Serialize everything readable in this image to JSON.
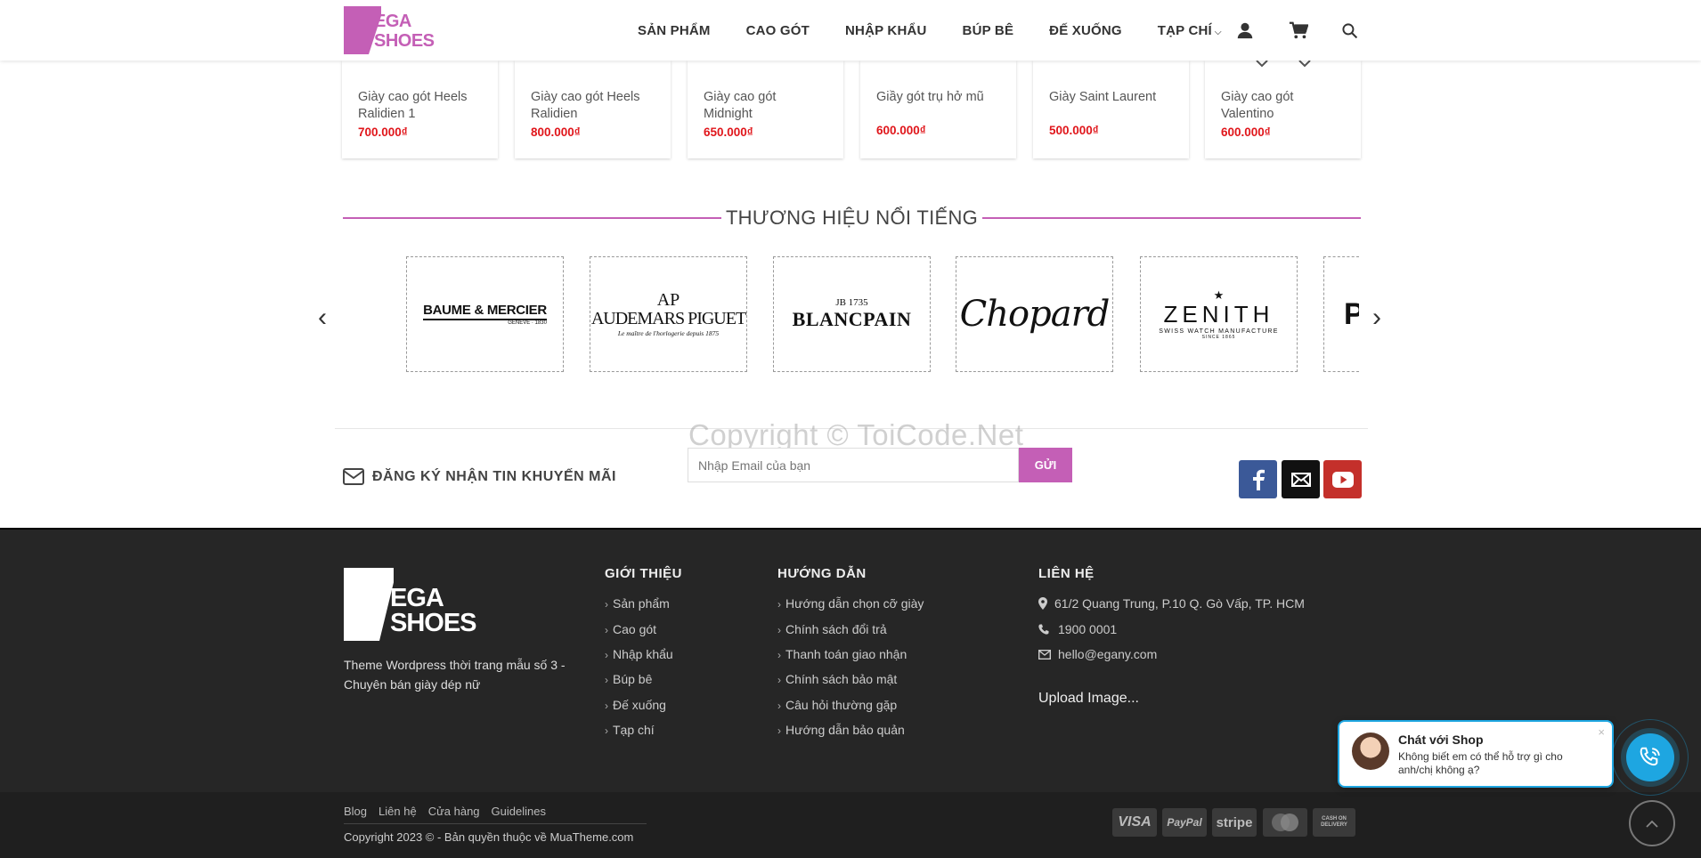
{
  "header": {
    "logo_line1": "EGA",
    "logo_line2": "SHOES",
    "nav": [
      "SẢN PHẨM",
      "CAO GÓT",
      "NHẬP KHẨU",
      "BÚP BÊ",
      "ĐẾ XUỐNG",
      "TẠP CHÍ"
    ],
    "icons": [
      "user-icon",
      "cart-icon",
      "search-icon"
    ]
  },
  "products": [
    {
      "name": "Giày cao gót Heels Ralidien 1",
      "price": "700.000₫"
    },
    {
      "name": "Giày cao gót Heels Ralidien",
      "price": "800.000₫"
    },
    {
      "name": "Giày cao gót Midnight",
      "price": "650.000₫"
    },
    {
      "name": "Giầy gót trụ hở mũ",
      "price": "600.000₫"
    },
    {
      "name": "Giày Saint Laurent",
      "price": "500.000₫"
    },
    {
      "name": "Giày cao gót Valentino",
      "price": "600.000₫"
    }
  ],
  "brands_section": {
    "title": "THƯƠNG HIỆU NỔI TIẾNG",
    "brands": [
      {
        "name": "BAUME & MERCIER",
        "sub": "GENEVE · 1830"
      },
      {
        "name": "AUDEMARS PIGUET",
        "sub": "Le maître de l'horlogerie depuis 1875",
        "mark": "AP"
      },
      {
        "name": "BLANCPAIN",
        "mark": "JB 1735"
      },
      {
        "name": "Chopard"
      },
      {
        "name": "ZENITH",
        "sub": "SWISS WATCH MANUFACTURE",
        "sub2": "SINCE 1865",
        "mark": "★"
      },
      {
        "name": "P"
      }
    ]
  },
  "watermark": "Copyright © ToiCode.Net",
  "newsletter": {
    "label": "ĐĂNG KÝ NHẬN TIN KHUYẾN MÃI",
    "placeholder": "Nhập Email của bạn",
    "button": "GỬI"
  },
  "social": [
    {
      "name": "facebook-icon",
      "color": "#3b5998"
    },
    {
      "name": "email-icon",
      "color": "#111111"
    },
    {
      "name": "youtube-icon",
      "color": "#c4302b"
    }
  ],
  "footer": {
    "logo_line1": "EGA",
    "logo_line2": "SHOES",
    "about": "Theme Wordpress thời trang mẫu số 3 - Chuyên bán giày dép nữ",
    "col1": {
      "title": "GIỚI THIỆU",
      "links": [
        "Sản phẩm",
        "Cao gót",
        "Nhập khẩu",
        "Búp bê",
        "Đế xuống",
        "Tạp chí"
      ]
    },
    "col2": {
      "title": "HƯỚNG DẪN",
      "links": [
        "Hướng dẫn chọn cỡ giày",
        "Chính sách đổi trả",
        "Thanh toán giao nhận",
        "Chính sách bảo mật",
        "Câu hỏi thường gặp",
        "Hướng dẫn bảo quản"
      ]
    },
    "col3": {
      "title": "LIÊN HỆ",
      "address": "61/2 Quang Trung, P.10 Q. Gò Vấp, TP. HCM",
      "phone": "1900 0001",
      "email": "hello@egany.com",
      "upload": "Upload Image..."
    },
    "bottom_links": [
      "Blog",
      "Liên hệ",
      "Cửa hàng",
      "Guidelines"
    ],
    "copyright": "Copyright 2023 © - Bản quyền thuộc về MuaTheme.com",
    "payments": [
      "VISA",
      "PayPal",
      "stripe",
      "MasterCard",
      "CASH ON DELIVERY"
    ]
  },
  "chat": {
    "title": "Chát với Shop",
    "message": "Không biết em có thể hỗ trợ gì cho anh/chị không ạ?",
    "close": "×"
  },
  "colors": {
    "accent": "#c45fb6",
    "price": "#e0161b",
    "chat": "#1ea6e1",
    "footer_bg": "#262626"
  }
}
